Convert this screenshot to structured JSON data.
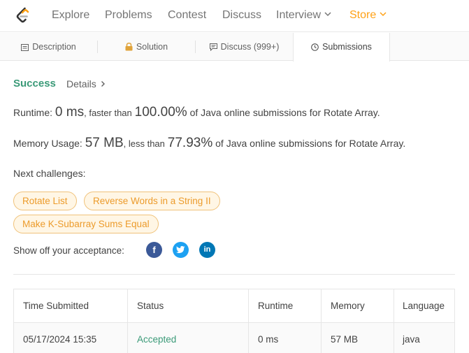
{
  "nav": {
    "items": [
      "Explore",
      "Problems",
      "Contest",
      "Discuss",
      "Interview",
      "Store"
    ],
    "logo_icon": "leetcode-logo-icon",
    "store_color": "#ffa116"
  },
  "tabs": [
    {
      "label": "Description",
      "icon": "document-icon"
    },
    {
      "label": "Solution",
      "icon": "lock-icon"
    },
    {
      "label": "Discuss (999+)",
      "icon": "chat-icon"
    },
    {
      "label": "Submissions",
      "icon": "clock-icon"
    }
  ],
  "result": {
    "status": "Success",
    "details": "Details",
    "runtime_label": "Runtime:",
    "runtime_value": "0 ms",
    "runtime_mid": ", faster than",
    "runtime_percent": "100.00%",
    "runtime_suffix": "of Java online submissions for Rotate Array.",
    "memory_label": "Memory Usage:",
    "memory_value": "57 MB",
    "memory_mid": ", less than",
    "memory_percent": "77.93%",
    "memory_suffix": "of Java online submissions for Rotate Array."
  },
  "next": {
    "label": "Next challenges:",
    "challenges": [
      "Rotate List",
      "Reverse Words in a String II",
      "Make K-Subarray Sums Equal"
    ]
  },
  "share": {
    "label": "Show off your acceptance:",
    "facebook": "f",
    "linkedin": "in"
  },
  "table": {
    "headers": [
      "Time Submitted",
      "Status",
      "Runtime",
      "Memory",
      "Language"
    ],
    "rows": [
      [
        "05/17/2024 15:35",
        "Accepted",
        "0 ms",
        "57 MB",
        "java"
      ]
    ]
  },
  "colors": {
    "success": "#3b9a78",
    "accent": "#ffa116",
    "chip_text": "#ec9b2b"
  }
}
